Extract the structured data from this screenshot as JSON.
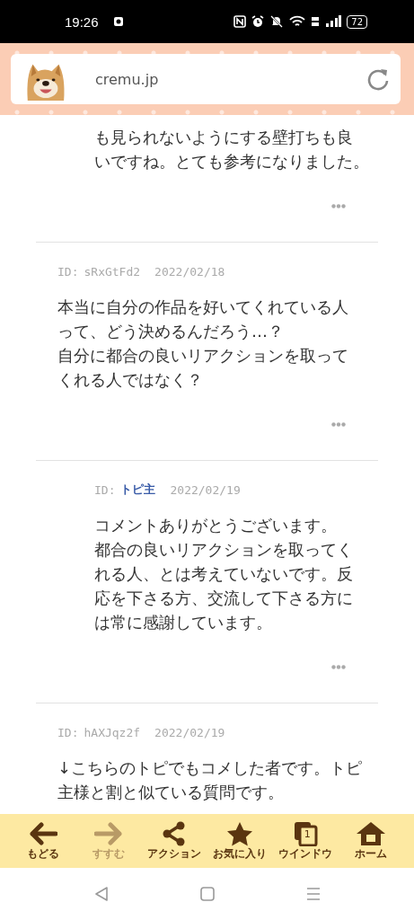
{
  "status_bar": {
    "time": "19:26",
    "battery": "72"
  },
  "address_bar": {
    "url": "cremu.jp"
  },
  "comments": [
    {
      "kind": "reply",
      "lines": [
        "も見られないようにする壁打ちも良",
        "いですね。とても参考になりました。"
      ]
    },
    {
      "kind": "comment",
      "id_label": "ID:",
      "id": "sRxGtFd2",
      "is_op": false,
      "date": "2022/02/18",
      "lines": [
        "本当に自分の作品を好いてくれている人",
        "って、どう決めるんだろう…？",
        "自分に都合の良いリアクションを取って",
        "くれる人ではなく？"
      ]
    },
    {
      "kind": "reply",
      "id_label": "ID:",
      "id": "トピ主",
      "is_op": true,
      "date": "2022/02/19",
      "lines": [
        "コメントありがとうございます。",
        "都合の良いリアクションを取ってく",
        "れる人、とは考えていないです。反",
        "応を下さる方、交流して下さる方に",
        "は常に感謝しています。"
      ]
    },
    {
      "kind": "comment",
      "id_label": "ID:",
      "id": "hAXJqz2f",
      "is_op": false,
      "date": "2022/02/19",
      "lines": [
        "↓こちらのトピでもコメした者です。トピ",
        "主様と割と似ている質問です。"
      ]
    }
  ],
  "toolbar": [
    {
      "label": "もどる",
      "disabled": false
    },
    {
      "label": "すすむ",
      "disabled": true
    },
    {
      "label": "アクション",
      "disabled": false
    },
    {
      "label": "お気に入り",
      "disabled": false
    },
    {
      "label": "ウインドウ",
      "disabled": false,
      "count": "1"
    },
    {
      "label": "ホーム",
      "disabled": false
    }
  ]
}
